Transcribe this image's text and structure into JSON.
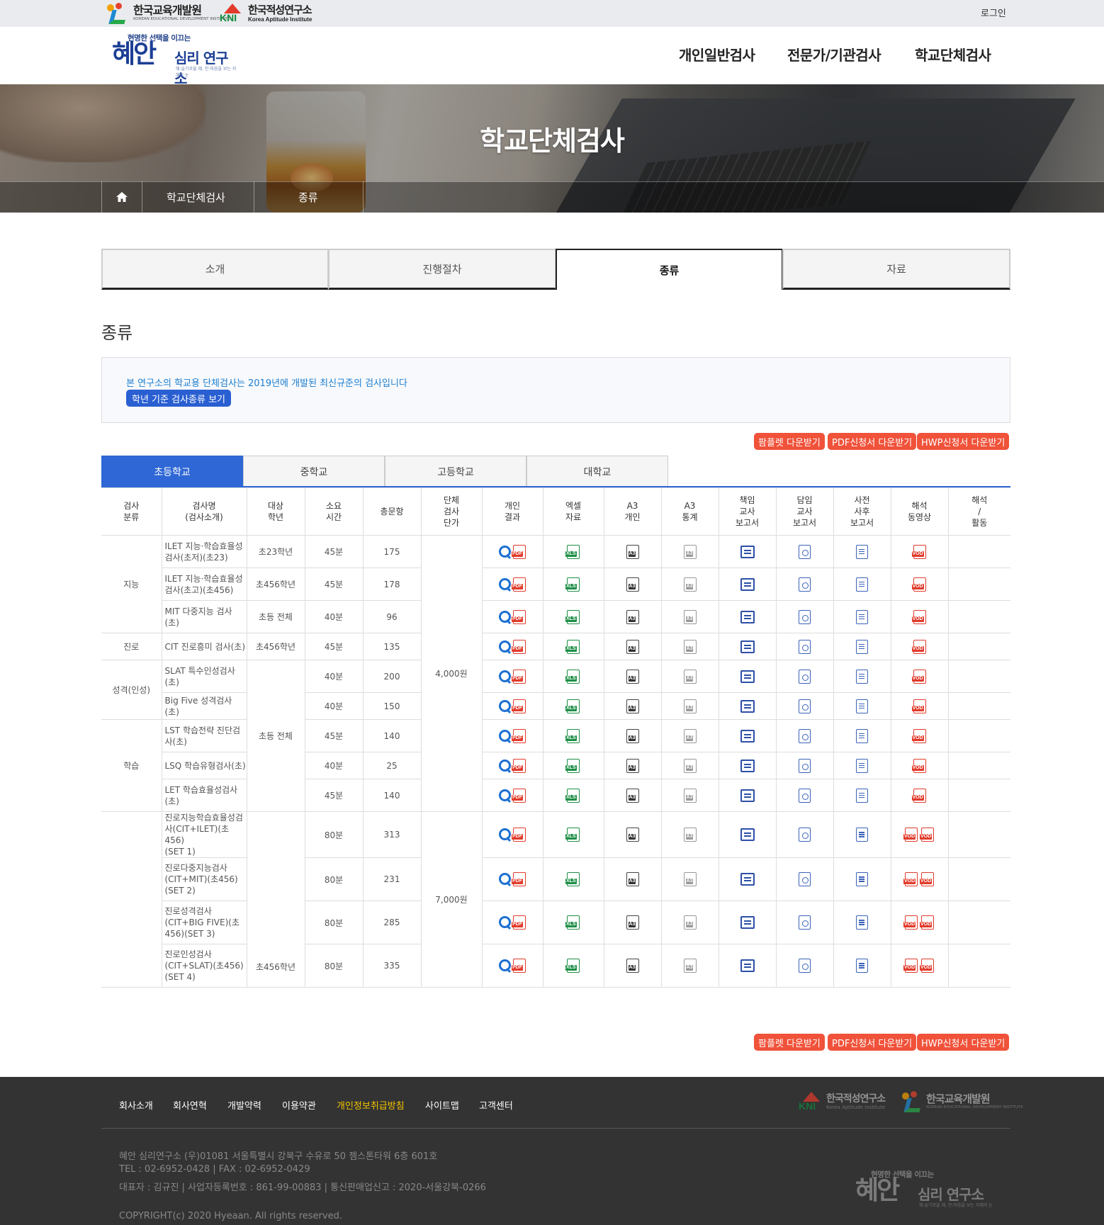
{
  "topbar": {
    "kedi_name": "한국교육개발원",
    "kedi_en": "KOREAN EDUCATIONAL DEVELOPMENT INSTITUTE",
    "kni_mark": "KNI",
    "kni_name": "한국적성연구소",
    "kni_en": "Korea Aptitude Institute",
    "login": "로그인"
  },
  "header": {
    "slogan": "현명한 선택을 이끄는",
    "logo_main": "혜안",
    "logo_sub": "심리 연구소",
    "logo_tagline": "혜:슬기로울 혜, 안:마음을 보는 지혜의 눈",
    "nav": [
      "개인일반검사",
      "전문가/기관검사",
      "학교단체검사"
    ]
  },
  "hero": {
    "title": "학교단체검사",
    "breadcrumb": [
      "학교단체검사",
      "종류"
    ]
  },
  "subtabs": [
    "소개",
    "진행절차",
    "종류",
    "자료"
  ],
  "section_title": "종류",
  "notice": {
    "text": "본 연구소의 학교용 단체검사는 2019년에 개발된 최신규준의 검사입니다",
    "button": "학년 기준 검사종류 보기"
  },
  "downloads": [
    "팜플렛 다운받기",
    "PDF신청서 다운받기",
    "HWP신청서 다운받기"
  ],
  "school_tabs": [
    "초등학교",
    "중학교",
    "고등학교",
    "대학교"
  ],
  "table": {
    "headers": [
      [
        "검사",
        "분류"
      ],
      [
        "검사명",
        "(검사소개)"
      ],
      [
        "대상",
        "학년"
      ],
      [
        "소요",
        "시간"
      ],
      [
        "총문항"
      ],
      [
        "단체",
        "검사",
        "단가"
      ],
      [
        "개인",
        "결과"
      ],
      [
        "엑셀",
        "자료"
      ],
      [
        "A3",
        "개인"
      ],
      [
        "A3",
        "통계"
      ],
      [
        "책임",
        "교사",
        "보고서"
      ],
      [
        "담임",
        "교사",
        "보고서"
      ],
      [
        "사전",
        "사후",
        "보고서"
      ],
      [
        "해석",
        "동영상"
      ],
      [
        "해석",
        "/",
        "활동"
      ]
    ],
    "categories": [
      "지능",
      "진로",
      "성격(인성)",
      "학습"
    ],
    "target_group": "초등 전체",
    "target_set": "초456학년",
    "price_single": "4,000원",
    "price_set": "7,000원",
    "rows": [
      {
        "name": [
          "ILET 지능·학습효율성",
          "검사(초저)(초23)"
        ],
        "target": "초23학년",
        "time": "45분",
        "items": "175"
      },
      {
        "name": [
          "ILET 지능·학습효율성",
          "검사(초고)(초456)"
        ],
        "target": "초456학년",
        "time": "45분",
        "items": "178"
      },
      {
        "name": [
          "MIT 다중지능 검사",
          "(초)"
        ],
        "target": "초등 전체",
        "time": "40분",
        "items": "96"
      },
      {
        "name": [
          "CIT 진로흥미 검사(초)"
        ],
        "target": "초456학년",
        "time": "45분",
        "items": "135"
      },
      {
        "name": [
          "SLAT 특수인성검사",
          "(초)"
        ],
        "time": "40분",
        "items": "200"
      },
      {
        "name": [
          "Big Five 성격검사(초)"
        ],
        "time": "40분",
        "items": "150"
      },
      {
        "name": [
          "LST 학습전략 진단검",
          "사(초)"
        ],
        "time": "45분",
        "items": "140"
      },
      {
        "name": [
          "LSQ 학습유형검사(초)"
        ],
        "time": "40분",
        "items": "25"
      },
      {
        "name": [
          "LET 학습효율성검사",
          "(초)"
        ],
        "time": "45분",
        "items": "140"
      },
      {
        "name": [
          "진로지능학습효율성검",
          "사(CIT+ILET)(초456)",
          "(SET 1)"
        ],
        "time": "80분",
        "items": "313"
      },
      {
        "name": [
          "진로다중지능검사",
          "(CIT+MIT)(초456)",
          "(SET 2)"
        ],
        "time": "80분",
        "items": "231"
      },
      {
        "name": [
          "진로성격검사",
          "(CIT+BIG FIVE)(초",
          "456)(SET 3)"
        ],
        "time": "80분",
        "items": "285"
      },
      {
        "name": [
          "진로인성검사",
          "(CIT+SLAT)(초456)",
          "(SET 4)"
        ],
        "time": "80분",
        "items": "335"
      }
    ],
    "icon_labels": {
      "pdf": "PDF",
      "xls": "XLS",
      "a3": "A3",
      "vod": "VOD"
    }
  },
  "footer": {
    "nav": [
      "회사소개",
      "회사연혁",
      "개발약력",
      "이용약관",
      "개인정보취급방침",
      "사이트맵",
      "고객센터"
    ],
    "highlight_color": "#f5c400",
    "info": [
      "혜안 심리연구소  (우)01081 서울특별시 강북구 수유로 50 젬스톤타워 6층 601호",
      "TEL : 02-6952-0428   |   FAX : 02-6952-0429",
      "대표자 : 김규진   |   사업자등록번호 : 861-99-00883   |   통신판매업신고 : 2020-서울강북-0266",
      "COPYRIGHT(c) 2020 Hyeaan. All rights reserved."
    ]
  }
}
